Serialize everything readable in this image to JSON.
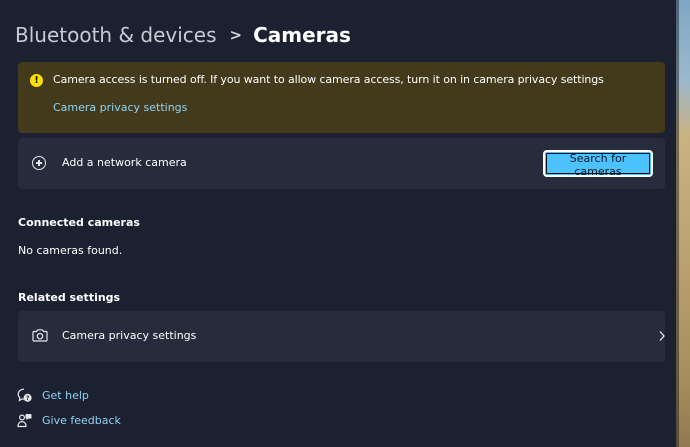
{
  "breadcrumb": {
    "parent": "Bluetooth & devices",
    "separator": ">",
    "current": "Cameras"
  },
  "warning": {
    "icon": "warning-icon",
    "message": "Camera access is turned off. If you want to allow camera access, turn it on in camera privacy settings",
    "link": "Camera privacy settings"
  },
  "add_camera": {
    "icon": "plus-circle-icon",
    "label": "Add a network camera",
    "button": "Search for cameras"
  },
  "connected": {
    "title": "Connected cameras",
    "empty": "No cameras found."
  },
  "related": {
    "title": "Related settings",
    "item_label": "Camera privacy settings",
    "item_icon": "camera-icon",
    "chevron": "chevron-right-icon"
  },
  "footer": {
    "help": "Get help",
    "feedback": "Give feedback"
  },
  "colors": {
    "background": "#1c2131",
    "card": "#262c3c",
    "warning_bg": "#433a1c",
    "accent": "#4cc2ff",
    "link": "#8fd3f4",
    "warning_icon": "#fce100"
  }
}
